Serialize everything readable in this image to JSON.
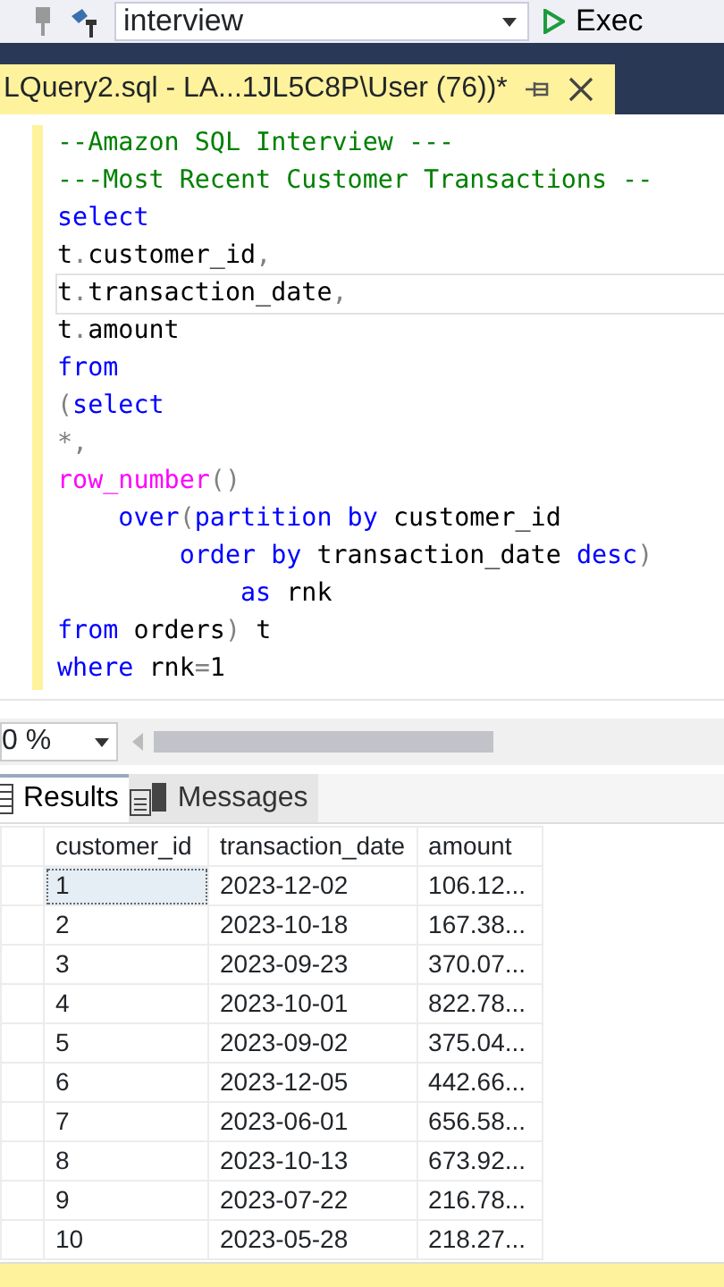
{
  "toolbar": {
    "database": "interview",
    "execute_label": "Exec"
  },
  "document_tab": {
    "title": "LQuery2.sql - LA...1JL5C8P\\User (76))*",
    "selected": true
  },
  "editor": {
    "lines": [
      {
        "current": false,
        "tokens": [
          {
            "kind": "comment",
            "text": "--Amazon SQL Interview ---"
          }
        ]
      },
      {
        "current": false,
        "tokens": [
          {
            "kind": "comment",
            "text": "---Most Recent Customer Transactions --"
          }
        ]
      },
      {
        "current": false,
        "tokens": [
          {
            "kind": "keyword",
            "text": "select"
          }
        ]
      },
      {
        "current": false,
        "tokens": [
          {
            "kind": "plain",
            "text": "t"
          },
          {
            "kind": "punct",
            "text": "."
          },
          {
            "kind": "plain",
            "text": "customer_id"
          },
          {
            "kind": "punct",
            "text": ","
          }
        ]
      },
      {
        "current": true,
        "tokens": [
          {
            "kind": "plain",
            "text": "t"
          },
          {
            "kind": "punct",
            "text": "."
          },
          {
            "kind": "plain",
            "text": "transaction_date"
          },
          {
            "kind": "punct",
            "text": ","
          }
        ]
      },
      {
        "current": false,
        "tokens": [
          {
            "kind": "plain",
            "text": "t"
          },
          {
            "kind": "punct",
            "text": "."
          },
          {
            "kind": "plain",
            "text": "amount"
          }
        ]
      },
      {
        "current": false,
        "tokens": [
          {
            "kind": "keyword",
            "text": "from"
          }
        ]
      },
      {
        "current": false,
        "tokens": [
          {
            "kind": "punct",
            "text": "("
          },
          {
            "kind": "keyword",
            "text": "select"
          }
        ]
      },
      {
        "current": false,
        "tokens": [
          {
            "kind": "punct",
            "text": "*,"
          }
        ]
      },
      {
        "current": false,
        "tokens": [
          {
            "kind": "function",
            "text": "row_number"
          },
          {
            "kind": "punct",
            "text": "()"
          }
        ]
      },
      {
        "current": false,
        "tokens": [
          {
            "kind": "keyword",
            "text": "    over"
          },
          {
            "kind": "punct",
            "text": "("
          },
          {
            "kind": "keyword",
            "text": "partition by "
          },
          {
            "kind": "plain",
            "text": "customer_id"
          }
        ]
      },
      {
        "current": false,
        "tokens": [
          {
            "kind": "keyword",
            "text": "        order by "
          },
          {
            "kind": "plain",
            "text": "transaction_date "
          },
          {
            "kind": "keyword",
            "text": "desc"
          },
          {
            "kind": "punct",
            "text": ")"
          }
        ]
      },
      {
        "current": false,
        "tokens": [
          {
            "kind": "keyword",
            "text": "            as "
          },
          {
            "kind": "plain",
            "text": "rnk"
          }
        ]
      },
      {
        "current": false,
        "tokens": [
          {
            "kind": "keyword",
            "text": "from "
          },
          {
            "kind": "plain",
            "text": "orders"
          },
          {
            "kind": "punct",
            "text": ") "
          },
          {
            "kind": "plain",
            "text": "t"
          }
        ]
      },
      {
        "current": false,
        "tokens": [
          {
            "kind": "keyword",
            "text": "where "
          },
          {
            "kind": "plain",
            "text": "rnk"
          },
          {
            "kind": "punct",
            "text": "="
          },
          {
            "kind": "plain",
            "text": "1"
          }
        ]
      }
    ]
  },
  "zoom": {
    "value": "0 %"
  },
  "result_tabs": [
    {
      "label": "Results",
      "selected": true
    },
    {
      "label": "Messages",
      "selected": false
    }
  ],
  "table": {
    "columns": [
      "customer_id",
      "transaction_date",
      "amount"
    ],
    "rows": [
      {
        "cells": [
          "1",
          "2023-12-02",
          "106.12..."
        ],
        "selected": true
      },
      {
        "cells": [
          "2",
          "2023-10-18",
          "167.38..."
        ],
        "selected": false
      },
      {
        "cells": [
          "3",
          "2023-09-23",
          "370.07..."
        ],
        "selected": false
      },
      {
        "cells": [
          "4",
          "2023-10-01",
          "822.78..."
        ],
        "selected": false
      },
      {
        "cells": [
          "5",
          "2023-09-02",
          "375.04..."
        ],
        "selected": false
      },
      {
        "cells": [
          "6",
          "2023-12-05",
          "442.66..."
        ],
        "selected": false
      },
      {
        "cells": [
          "7",
          "2023-06-01",
          "656.58..."
        ],
        "selected": false
      },
      {
        "cells": [
          "8",
          "2023-10-13",
          "673.92..."
        ],
        "selected": false
      },
      {
        "cells": [
          "9",
          "2023-07-22",
          "216.78..."
        ],
        "selected": false
      },
      {
        "cells": [
          "10",
          "2023-05-28",
          "218.27..."
        ],
        "selected": false
      }
    ]
  }
}
